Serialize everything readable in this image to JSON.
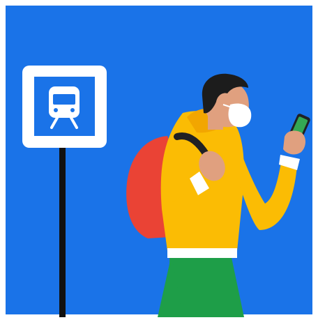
{
  "scene": {
    "colors": {
      "background": "#1a73e8",
      "frame": "#ffffff",
      "pole": "#111111",
      "hair": "#1c1c1c",
      "skin": "#e0a07f",
      "mask": "#ffffff",
      "hoodie": "#fbbc04",
      "hoodie_shade": "#f2a600",
      "backpack": "#ea4335",
      "strap": "#202124",
      "cuff": "#ffffff",
      "phone_screen": "#34a853",
      "pants": "#1e9e48"
    },
    "icons": [
      "train-station-sign-icon",
      "smartphone-icon"
    ]
  }
}
